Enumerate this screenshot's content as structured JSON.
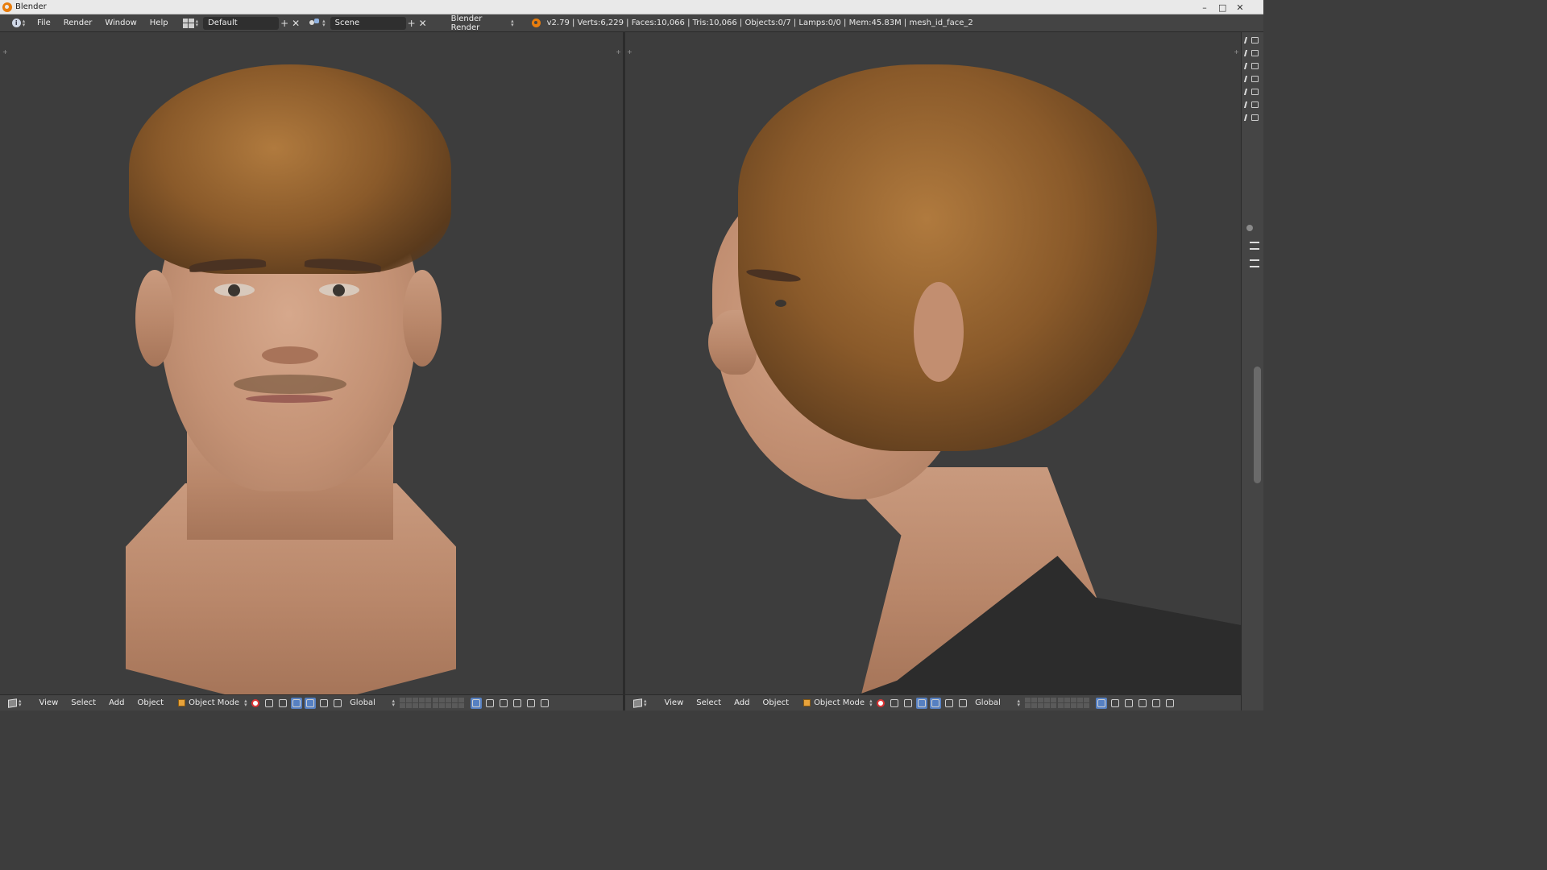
{
  "window": {
    "title": "Blender",
    "controls": {
      "minimize": "–",
      "maximize": "□",
      "close": "✕"
    }
  },
  "info_header": {
    "menus": [
      "File",
      "Render",
      "Window",
      "Help"
    ],
    "screen_layout": "Default",
    "scene": "Scene",
    "render_engine": "Blender Render",
    "stats": "v2.79 | Verts:6,229 | Faces:10,066 | Tris:10,066 | Objects:0/7 | Lamps:0/0 | Mem:45.83M | mesh_id_face_2"
  },
  "viewport_left": {
    "menus": [
      "View",
      "Select",
      "Add",
      "Object"
    ],
    "mode": "Object Mode",
    "orientation": "Global"
  },
  "viewport_right": {
    "menus": [
      "View",
      "Select",
      "Add",
      "Object"
    ],
    "mode": "Object Mode",
    "orientation": "Global"
  },
  "icons": {
    "editor_type": "info-icon",
    "view3d": "cube-icon",
    "layout": "screen-layout-icon",
    "scene": "scene-icon",
    "blender": "blender-logo-icon"
  },
  "colors": {
    "viewport_bg": "#3d3d3d",
    "header_bg": "#444444",
    "selected": "#5680c2",
    "blender_orange": "#e87d0d"
  }
}
